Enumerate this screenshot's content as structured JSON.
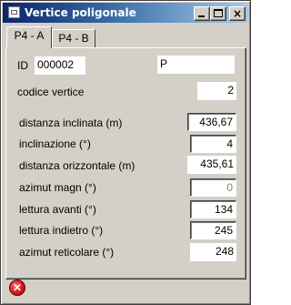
{
  "window": {
    "title": "Vertice poligonale"
  },
  "titlebar": {
    "minimize_glyph": "_",
    "close_glyph": "×"
  },
  "tabs": [
    {
      "label": "P4 - A"
    },
    {
      "label": "P4 - B"
    }
  ],
  "form": {
    "id_label": "ID",
    "id_value": "000002",
    "p_value": "P",
    "codice_label": "codice vertice",
    "codice_value": "2",
    "rows": [
      {
        "label": "distanza inclinata (m)",
        "value": "436,67"
      },
      {
        "label": "inclinazione (°)",
        "value": "4"
      },
      {
        "label": "distanza orizzontale (m)",
        "value": "435,61"
      },
      {
        "label": "azimut magn (°)",
        "value": "0"
      },
      {
        "label": "lettura avanti (°)",
        "value": "134"
      },
      {
        "label": "lettura indietro (°)",
        "value": "245"
      },
      {
        "label": "azimut reticolare (°)",
        "value": "248"
      }
    ]
  },
  "status": {
    "icon": "error-close-icon",
    "glyph": "✕"
  }
}
